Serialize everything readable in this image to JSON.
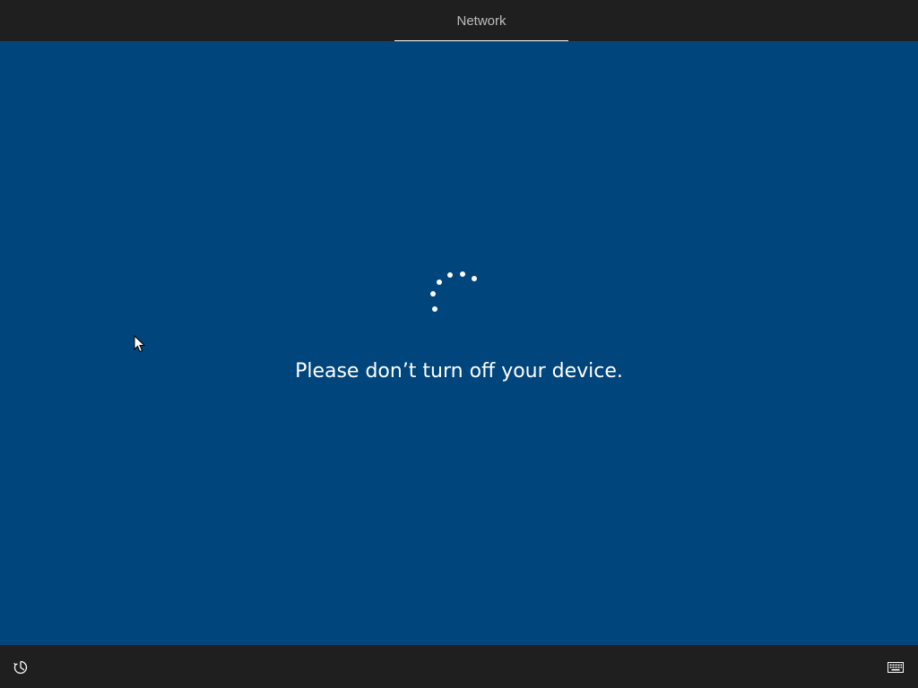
{
  "header": {
    "tabs": [
      {
        "label": "Network",
        "active": true
      }
    ]
  },
  "main": {
    "message": "Please don’t turn off your device.",
    "background_color": "#00457c",
    "spinner": "loading-spinner"
  },
  "footer": {
    "left_icon": "ease-of-access-icon",
    "right_icon": "keyboard-icon"
  },
  "colors": {
    "bar_background": "#1f1f1f",
    "accent_underline": "#ffffff",
    "text": "#ffffff",
    "tab_text": "#bdbdbd"
  }
}
